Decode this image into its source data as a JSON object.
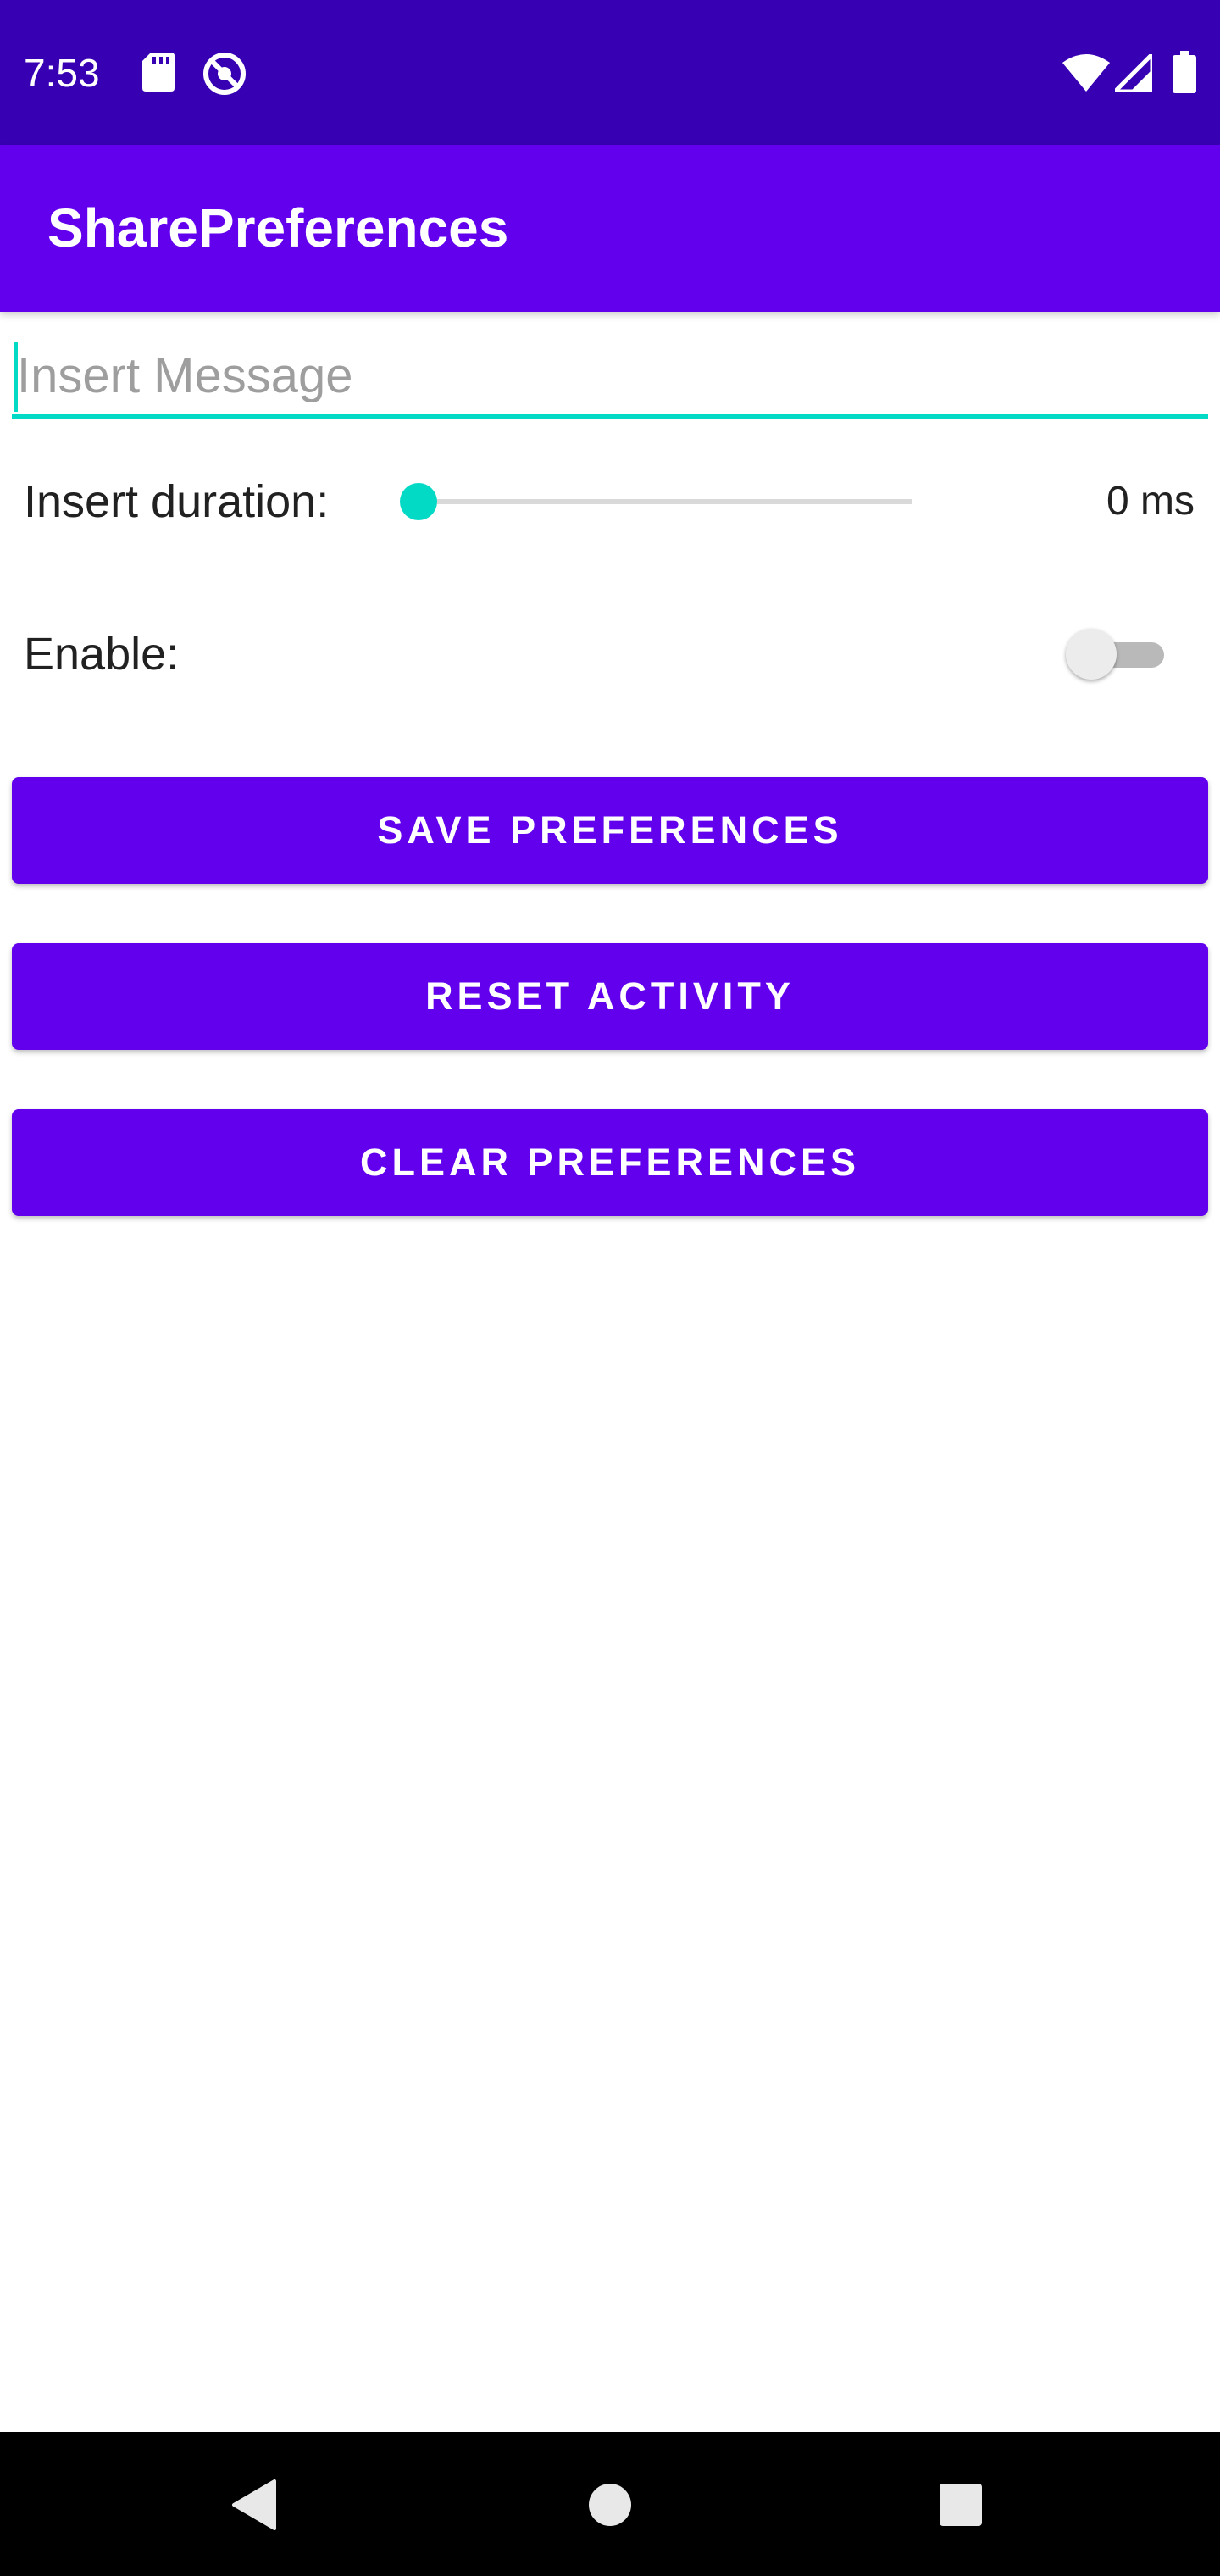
{
  "status_bar": {
    "time": "7:53",
    "icons": [
      "sd-card-icon",
      "sync-icon",
      "wifi-icon",
      "signal-icon",
      "battery-icon"
    ],
    "background_color": "#3700b3"
  },
  "app_bar": {
    "title": "SharePreferences",
    "background_color": "#6200ee"
  },
  "message_input": {
    "value": "",
    "placeholder": "Insert Message"
  },
  "duration": {
    "label": "Insert duration:",
    "value_text": "0 ms",
    "slider_fraction": 0
  },
  "enable": {
    "label": "Enable:",
    "checked": false
  },
  "buttons": {
    "save": "SAVE PREFERENCES",
    "reset": "RESET ACTIVITY",
    "clear": "CLEAR PREFERENCES"
  },
  "nav_bar": {
    "icons": [
      "back-icon",
      "home-icon",
      "recents-icon"
    ]
  },
  "colors": {
    "primary": "#6200ee",
    "primary_dark": "#3700b3",
    "accent": "#03dac5"
  }
}
